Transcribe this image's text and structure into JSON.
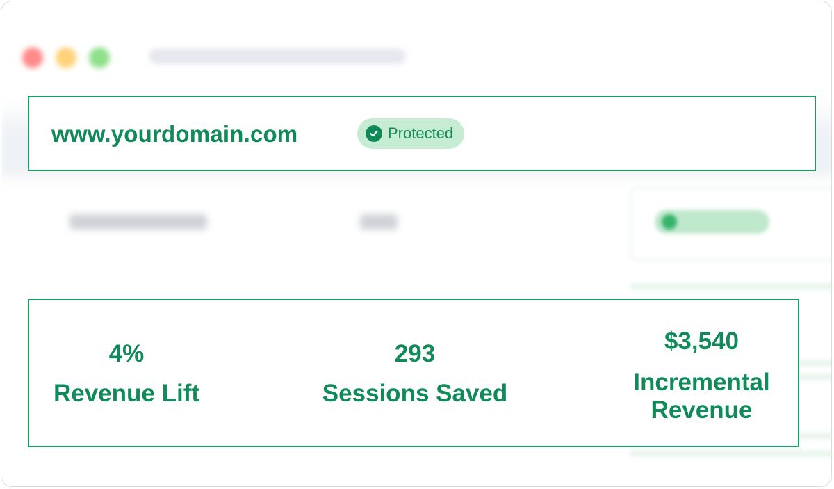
{
  "site": {
    "domain": "www.yourdomain.com",
    "status_label": "Protected",
    "status_icon": "check-circle-icon",
    "accent_color": "#0f8a58",
    "badge_color": "#c6ecd3"
  },
  "stats": [
    {
      "value": "4%",
      "label": "Revenue Lift"
    },
    {
      "value": "293",
      "label": "Sessions Saved"
    },
    {
      "value": "$3,540",
      "label": "Incremental Revenue"
    }
  ]
}
